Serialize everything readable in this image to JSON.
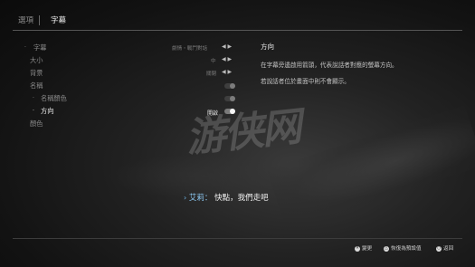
{
  "header": {
    "tabs": [
      {
        "label": "選項",
        "active": false
      },
      {
        "label": "字幕",
        "active": true
      }
    ]
  },
  "menu": {
    "items": [
      {
        "label": "字幕",
        "indent": 0,
        "bullet": "·",
        "value": "劇情・戰鬥對話",
        "control": "arrows"
      },
      {
        "label": "大小",
        "indent": 1,
        "value": "中",
        "control": "arrows"
      },
      {
        "label": "背景",
        "indent": 1,
        "value": "關閉",
        "control": "arrows"
      },
      {
        "label": "名稱",
        "indent": 1,
        "value": "",
        "control": "toggle"
      },
      {
        "label": "名稱顏色",
        "indent": 2,
        "bullet": "·",
        "value": "",
        "control": "toggle"
      },
      {
        "label": "方向",
        "indent": 2,
        "bullet": "·",
        "value": "開啟",
        "control": "toggle",
        "selected": true
      },
      {
        "label": "顏色",
        "indent": 1,
        "value": "",
        "control": "none"
      }
    ]
  },
  "description": {
    "title": "方向",
    "paragraphs": [
      "在字幕旁邊啟用箭頭，代表說話者對應的螢幕方向。",
      "若說話者位於畫面中則不會顯示。"
    ]
  },
  "subtitle": {
    "chevron": "›",
    "speaker": "艾莉：",
    "line": "快點，我們走吧"
  },
  "footer": {
    "hints": [
      {
        "button": "✕",
        "label": "變更"
      },
      {
        "button": "△",
        "label": "恢復為預設值"
      },
      {
        "button": "○",
        "label": "返回"
      }
    ]
  },
  "watermark": "游侠网",
  "arrows_glyph": "◀ ▶",
  "colors": {
    "accent": "#8cc8f2",
    "bright_text": "#f0f0f0",
    "dim_text": "#8a8a8a"
  }
}
